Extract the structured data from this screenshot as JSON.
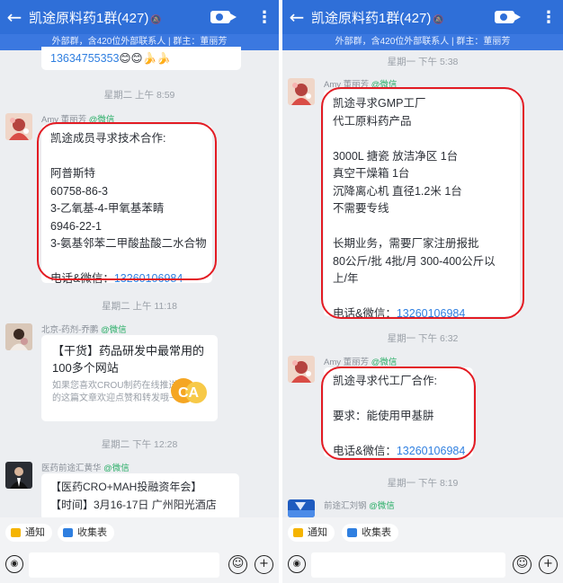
{
  "left": {
    "header": {
      "title": "凯途原料药1群(427)",
      "subtitle": "外部群，含420位外部联系人 | 群主：董丽芳"
    },
    "partial_text": "13634755353",
    "partial_emoji": "😊😊🍌🍌",
    "messages": [
      {
        "timestamp": "星期二 上午 8:59",
        "sender": "Amy 董丽芳",
        "source": "@微信",
        "lines": [
          "凯途成员寻求技术合作:",
          "",
          "阿普斯特",
          "60758-86-3",
          "3-乙氧基-4-甲氧基苯睛",
          "6946-22-1",
          "3-氨基邻苯二甲酸盐酸二水合物",
          "",
          "电话&微信："
        ],
        "phone": "13260106984"
      }
    ],
    "card_msg": {
      "timestamp": "星期二 上午 11:18",
      "sender": "北京-药剂-乔鹏",
      "source": "@微信",
      "title": "【干货】药品研发中最常用的100多个网站",
      "desc": "如果您喜欢CROU制药在线推送的这篇文章欢迎点赞和转发哦~",
      "logo": "CA"
    },
    "last_msg": {
      "timestamp": "星期二 下午 12:28",
      "sender": "医药前途汇黄华",
      "source": "@微信",
      "lines": [
        "【医药CRO+MAH投融资年会】",
        "【时间】3月16-17日 广州阳光酒店"
      ]
    },
    "quick_actions": [
      "通知",
      "收集表"
    ]
  },
  "right": {
    "header": {
      "title": "凯途原料药1群(427)",
      "subtitle": "外部群，含420位外部联系人 | 群主：董丽芳"
    },
    "messages": [
      {
        "timestamp": "星期一 下午 5:38",
        "sender": "Amy 董丽芳",
        "source": "@微信",
        "lines": [
          "凯途寻求GMP工厂",
          "代工原料药产品",
          "",
          "3000L 搪瓷 放洁净区 1台",
          "真空干燥箱 1台",
          "沉降离心机 直径1.2米 1台",
          "不需要专线",
          "",
          "长期业务，需要厂家注册报批",
          "80公斤/批 4批/月 300-400公斤以",
          "上/年",
          "",
          "电话&微信："
        ],
        "phone": "13260106984"
      },
      {
        "timestamp": "星期一 下午 6:32",
        "sender": "Amy 董丽芳",
        "source": "@微信",
        "lines": [
          "凯途寻求代工厂合作:",
          "",
          "要求：能使用甲基肼",
          "",
          "电话&微信："
        ],
        "phone": "13260106984"
      }
    ],
    "last_msg": {
      "timestamp": "星期一 下午 8:19",
      "sender": "前途汇刘钢",
      "source": "@微信"
    },
    "quick_actions": [
      "通知",
      "收集表"
    ]
  },
  "colors": {
    "header": "#2f6fd8",
    "subbar": "#3b78e0",
    "highlight": "#e31b23",
    "link": "#2f7fe0",
    "wechat": "#2aae67"
  },
  "icons": [
    "back-arrow-icon",
    "video-call-icon",
    "more-icon",
    "voice-icon",
    "emoji-icon",
    "plus-icon",
    "megaphone-icon",
    "form-icon"
  ]
}
